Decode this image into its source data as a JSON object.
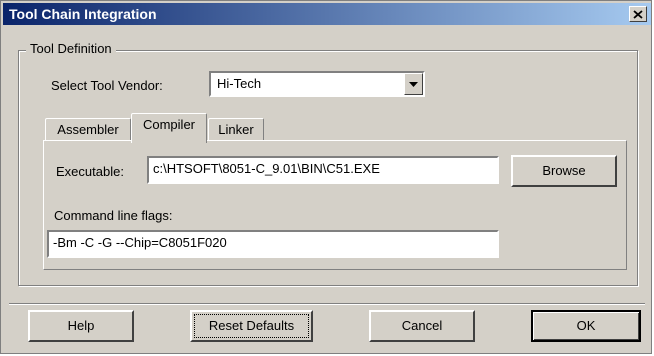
{
  "window": {
    "title": "Tool Chain Integration",
    "close_icon": "close-x-icon"
  },
  "group": {
    "legend": "Tool Definition"
  },
  "vendor": {
    "label": "Select Tool Vendor:",
    "value": "Hi-Tech",
    "arrow_icon": "dropdown-arrow-icon"
  },
  "tabs": [
    {
      "label": "Assembler",
      "active": false
    },
    {
      "label": "Compiler",
      "active": true
    },
    {
      "label": "Linker",
      "active": false
    }
  ],
  "executable": {
    "label": "Executable:",
    "value": "c:\\HTSOFT\\8051-C_9.01\\BIN\\C51.EXE",
    "browse_label": "Browse"
  },
  "flags": {
    "label": "Command line flags:",
    "value": "-Bm -C -G --Chip=C8051F020"
  },
  "buttons": {
    "help": "Help",
    "reset": "Reset Defaults",
    "cancel": "Cancel",
    "ok": "OK"
  }
}
